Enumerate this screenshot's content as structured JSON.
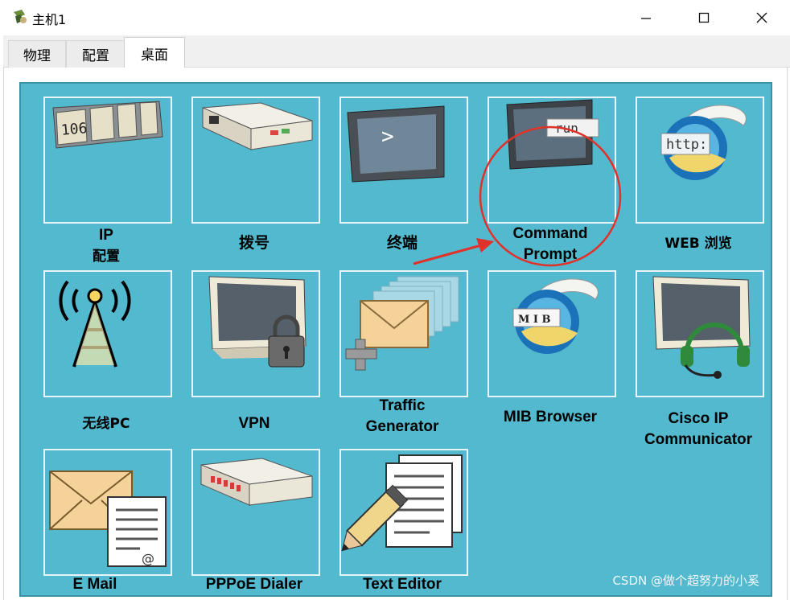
{
  "window": {
    "title": "主机1",
    "minimize_glyph": "—",
    "maximize_glyph": "☐",
    "close_glyph": "✕"
  },
  "tabs": [
    {
      "label": "物理",
      "active": false
    },
    {
      "label": "配置",
      "active": false
    },
    {
      "label": "桌面",
      "active": true
    }
  ],
  "desktop": {
    "background": "#52b9cf",
    "apps": [
      {
        "id": "ip-config",
        "line1": "IP",
        "line2": "配置",
        "icon": "ip-config-icon"
      },
      {
        "id": "dialup",
        "line1": "拨号",
        "line2": "",
        "icon": "modem-icon"
      },
      {
        "id": "terminal",
        "line1": "终端",
        "line2": "",
        "icon": "terminal-icon"
      },
      {
        "id": "command-prompt",
        "line1": "Command",
        "line2": "Prompt",
        "icon": "command-prompt-icon",
        "run_text": "run"
      },
      {
        "id": "web-browser",
        "line1": "WEB 浏览",
        "line2": "",
        "icon": "web-browser-icon",
        "badge_text": "http:"
      },
      {
        "id": "wireless-pc",
        "line1": "无线PC",
        "line2": "",
        "icon": "wireless-tower-icon"
      },
      {
        "id": "vpn",
        "line1": "VPN",
        "line2": "",
        "icon": "vpn-lock-icon"
      },
      {
        "id": "traffic-generator",
        "line1": "Traffic",
        "line2": "Generator",
        "icon": "traffic-generator-icon"
      },
      {
        "id": "mib-browser",
        "line1": "MIB Browser",
        "line2": "",
        "icon": "mib-browser-icon",
        "badge_text": "M I B"
      },
      {
        "id": "cisco-ip-communicator",
        "line1": "Cisco IP",
        "line2": "Communicator",
        "icon": "headset-icon"
      },
      {
        "id": "email",
        "line1": "E Mail",
        "line2": "",
        "icon": "email-icon"
      },
      {
        "id": "pppoe-dialer",
        "line1": "PPPoE Dialer",
        "line2": "",
        "icon": "pppoe-modem-icon"
      },
      {
        "id": "text-editor",
        "line1": "Text Editor",
        "line2": "",
        "icon": "text-editor-icon"
      }
    ],
    "ip_icon_text": "106"
  },
  "annotation": {
    "circle_color": "#e0322b",
    "arrow_color": "#e0322b"
  },
  "watermark": "CSDN @做个超努力的小奚"
}
